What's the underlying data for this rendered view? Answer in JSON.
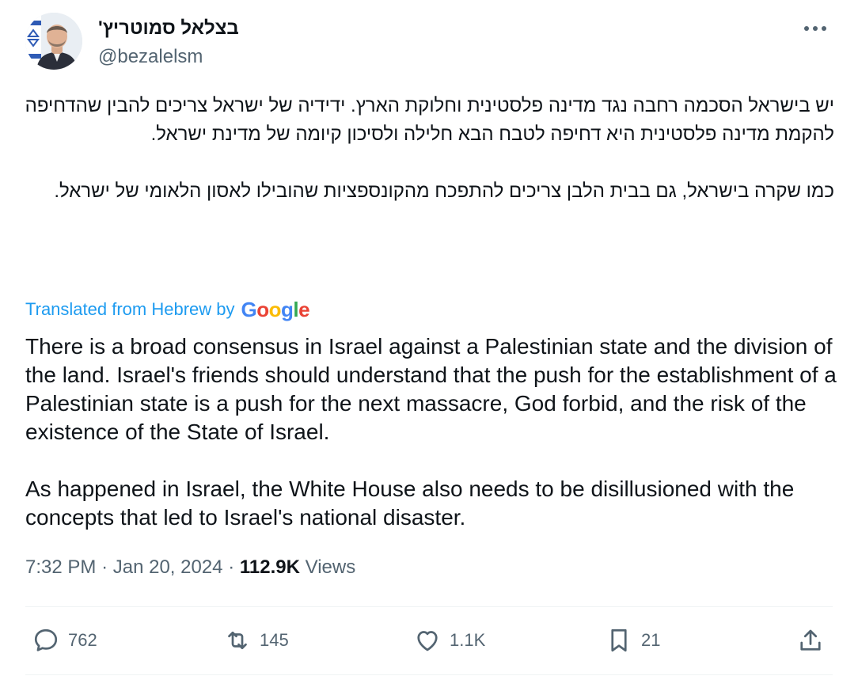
{
  "author": {
    "display_name": "בצלאל סמוטריץ'",
    "handle": "@bezalelsm"
  },
  "tweet": {
    "hebrew_paragraphs": [
      "יש בישראל הסכמה רחבה נגד מדינה פלסטינית וחלוקת הארץ. ידידיה של ישראל צריכים להבין שהדחיפה להקמת מדינה פלסטינית היא דחיפה לטבח הבא חלילה ולסיכון קיומה של מדינת ישראל.",
      "כמו שקרה בישראל, גם בבית הלבן צריכים להתפכח מהקונספציות שהובילו לאסון הלאומי של ישראל."
    ],
    "translated_label": "Translated from Hebrew by",
    "translation_provider": "Google",
    "english_paragraphs": [
      "There is a broad consensus in Israel against a Palestinian state and the division of the land. Israel's friends should understand that the push for the establishment of a Palestinian state is a push for the next massacre, God forbid, and the risk of the existence of the State of Israel.",
      "As happened in Israel, the White House also needs to be disillusioned with the concepts that led to Israel's national disaster."
    ]
  },
  "meta": {
    "time": "7:32 PM",
    "date": "Jan 20, 2024",
    "separator": "·",
    "views_count": "112.9K",
    "views_label": "Views"
  },
  "actions": {
    "replies": "762",
    "reposts": "145",
    "likes": "1.1K",
    "bookmarks": "21"
  },
  "icons": {
    "more": "more-horizontal-icon",
    "reply": "reply-bubble-icon",
    "repost": "repost-arrows-icon",
    "like": "heart-icon",
    "bookmark": "bookmark-icon",
    "share": "share-upload-icon"
  },
  "colors": {
    "text_primary": "#0f1419",
    "text_secondary": "#536471",
    "link_blue": "#1d9bf0",
    "divider": "#eff3f4"
  }
}
